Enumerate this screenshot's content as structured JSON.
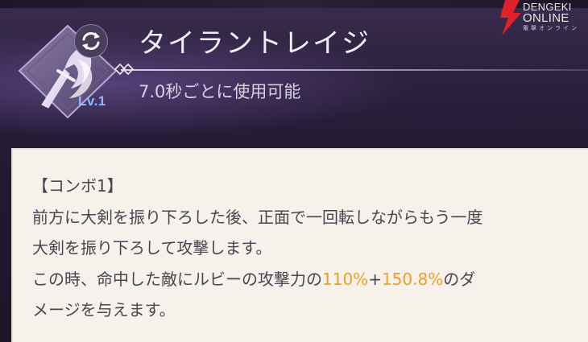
{
  "skill": {
    "name": "タイラントレイジ",
    "level": "Lv.1",
    "cooldown": "7.0秒ごとに使用可能"
  },
  "watermark": {
    "line1": "DENGEKI",
    "line2": "ONLINE",
    "line3": "電撃オンライン"
  },
  "description": {
    "header": "【コンボ1】",
    "line2": "前方に大剣を振り下ろした後、正面で一回転しながらもう一度",
    "line3": "大剣を振り下ろして攻撃します。",
    "line4_prefix": "この時、命中した敵にルビーの攻撃力の",
    "value1": "110%",
    "plus": "+",
    "value2": "150.8%",
    "line4_suffix": "のダ",
    "line5": "メージを与えます。"
  },
  "colors": {
    "highlight": "#f0a020",
    "level_text": "#8fb6ff",
    "panel_bg": "#f7f1ec",
    "header_bg": "#2e2240",
    "watermark_red": "#e0202a"
  },
  "icons": {
    "skill": "sword-flame-icon",
    "refresh": "refresh-icon",
    "watermark": "lightning-bolt-icon"
  }
}
